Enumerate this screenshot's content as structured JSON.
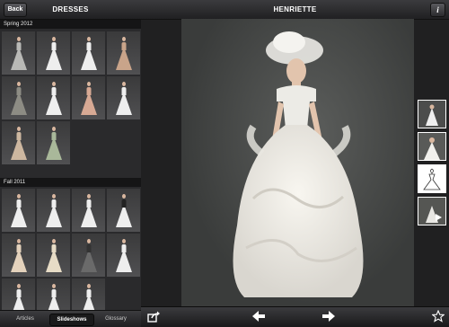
{
  "sidebar": {
    "back_label": "Back",
    "title": "DRESSES",
    "sections": [
      {
        "label": "Spring 2012"
      },
      {
        "label": "Fall 2011"
      }
    ],
    "tabs": [
      {
        "label": "Articles"
      },
      {
        "label": "Slideshows"
      },
      {
        "label": "Glossary"
      }
    ]
  },
  "main": {
    "title": "HENRIETTE",
    "info_label": "i",
    "footer": {
      "share_icon": "share-icon",
      "prev_icon": "arrow-left-icon",
      "next_icon": "arrow-right-icon",
      "favorite_icon": "star-icon"
    }
  },
  "colors": {
    "bar": "#2b2b2e",
    "background": "#202021",
    "dress": "#eeeeee"
  }
}
